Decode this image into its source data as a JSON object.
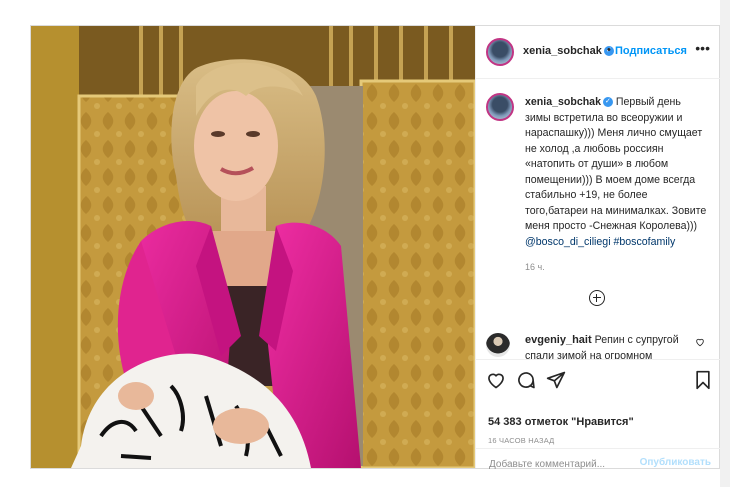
{
  "post": {
    "username": "xenia_sobchak",
    "follow_label": "Подписаться",
    "separator": "•",
    "more_label": "•••",
    "caption_text": "Первый день зимы встретила во всеоружии и нараспашку))) Меня лично смущает не холод ,а любовь россиян «натопить от души» в любом помещении))) В моем доме всегда стабильно +19, не более того,батареи на минималках. Зовите меня просто -Снежная Королева)))",
    "caption_mention": "@bosco_di_ciliegi",
    "caption_hashtag": "#boscofamily",
    "caption_time": "16 ч.",
    "comment": {
      "username": "evgeniy_hait",
      "text": "Репин с супругой спали зимой на огромном балконе.Под двумя одеялами.И, как рассказывали их"
    },
    "likes": "54 383 отметок \"Нравится\"",
    "posted_ago": "16 ЧАСОВ НАЗАД",
    "add_comment_placeholder": "Добавьте комментарий...",
    "publish_label": "Опубликовать"
  },
  "icons": {
    "verified": "verified-badge-icon",
    "like": "heart-icon",
    "comment": "comment-icon",
    "share": "paper-plane-icon",
    "save": "bookmark-icon",
    "load_more": "plus-circle-icon"
  },
  "colors": {
    "link_blue": "#0095f6",
    "mention": "#00376b",
    "muted": "#8e8e8e",
    "jacket": "#d91a8f"
  }
}
